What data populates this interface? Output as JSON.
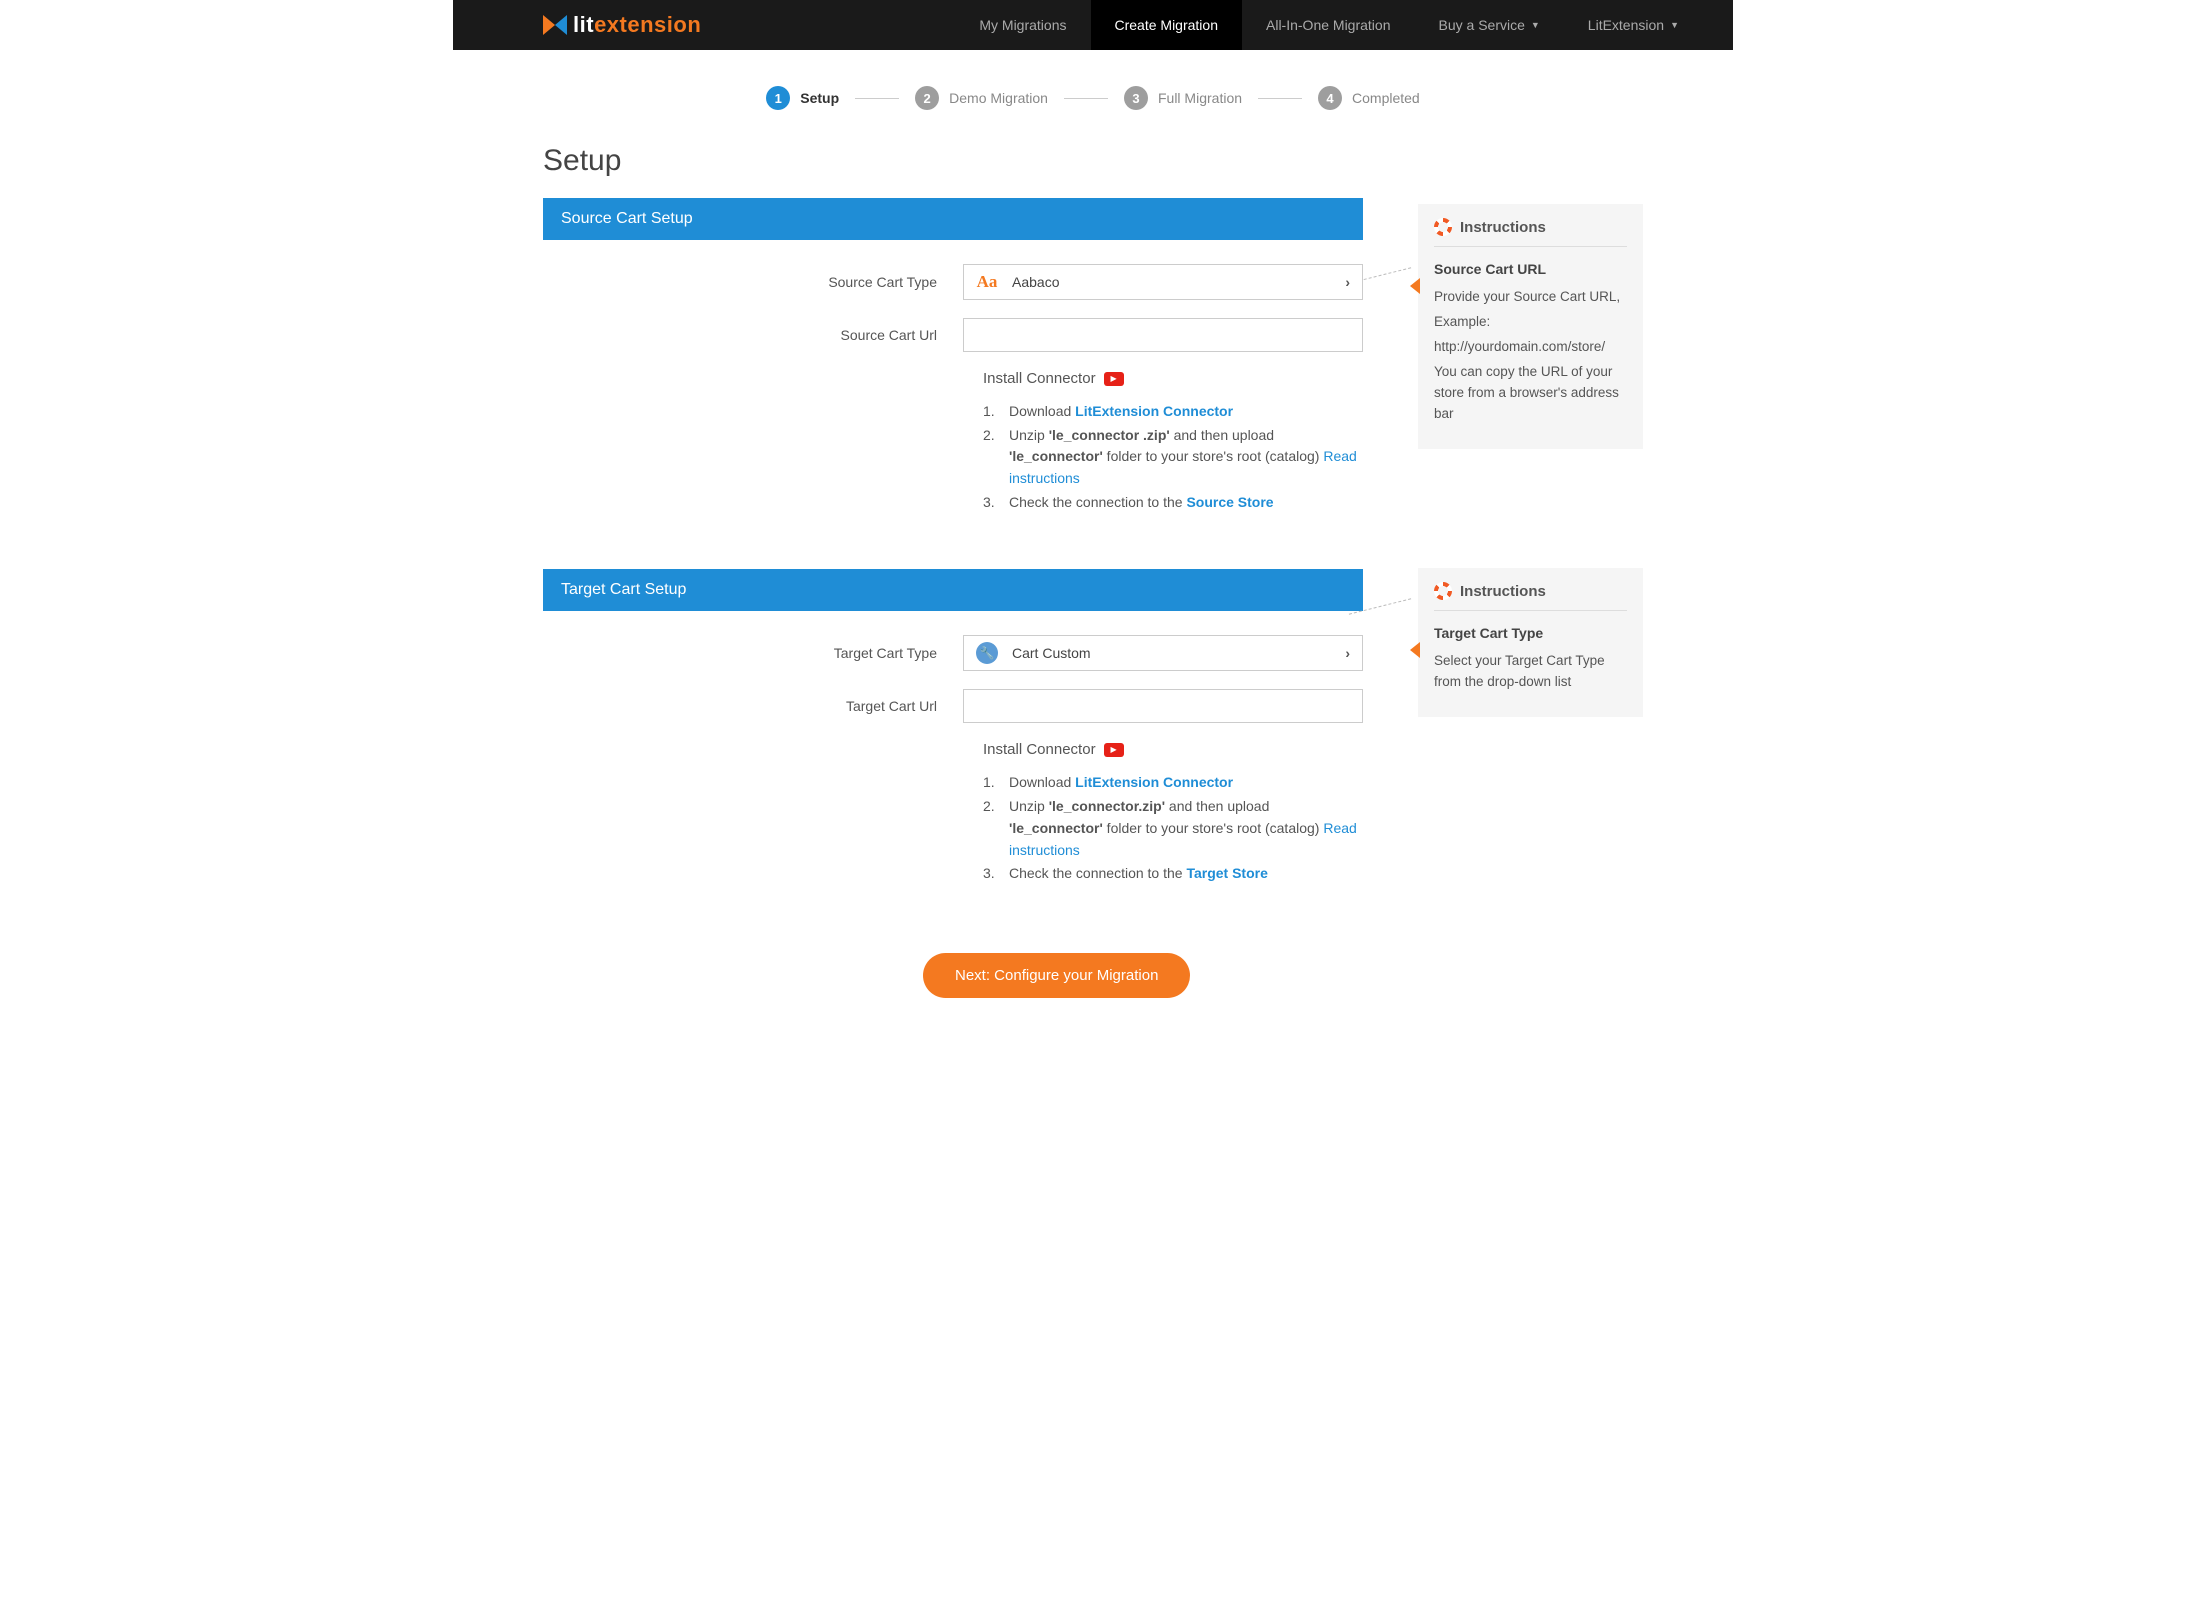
{
  "nav": {
    "brand_lit": "lit",
    "brand_ext": "extension",
    "items": [
      {
        "label": "My Migrations"
      },
      {
        "label": "Create Migration"
      },
      {
        "label": "All-In-One Migration"
      },
      {
        "label": "Buy a Service"
      },
      {
        "label": "LitExtension"
      }
    ]
  },
  "steps": [
    {
      "num": "1",
      "label": "Setup"
    },
    {
      "num": "2",
      "label": "Demo Migration"
    },
    {
      "num": "3",
      "label": "Full Migration"
    },
    {
      "num": "4",
      "label": "Completed"
    }
  ],
  "page_title": "Setup",
  "source": {
    "banner": "Source Cart Setup",
    "type_label": "Source Cart Type",
    "type_value": "Aabaco",
    "url_label": "Source Cart Url",
    "url_value": "",
    "install_title": "Install Connector",
    "connector": {
      "step1_pre": "Download ",
      "step1_link": "LitExtension Connector",
      "step2_a": "Unzip ",
      "step2_b": "'le_connector .zip'",
      "step2_c": " and then upload ",
      "step2_d": "'le_connector'",
      "step2_e": " folder to your store's root (catalog) ",
      "step2_link": "Read instructions",
      "step3_pre": "Check the connection to the ",
      "step3_link": "Source Store"
    }
  },
  "target": {
    "banner": "Target Cart Setup",
    "type_label": "Target Cart Type",
    "type_value": "Cart Custom",
    "url_label": "Target Cart Url",
    "url_value": "",
    "install_title": "Install Connector",
    "connector": {
      "step1_pre": "Download ",
      "step1_link": "LitExtension Connector",
      "step2_a": "Unzip ",
      "step2_b": "'le_connector.zip'",
      "step2_c": " and then upload ",
      "step2_d": "'le_connector'",
      "step2_e": " folder to your store's root (catalog) ",
      "step2_link": "Read instructions",
      "step3_pre": "Check the connection to the ",
      "step3_link": "Target Store"
    }
  },
  "instructions1": {
    "title": "Instructions",
    "subtitle": "Source Cart URL",
    "line1": "Provide your Source Cart URL,",
    "line2": "Example:",
    "line3": "http://yourdomain.com/store/",
    "line4": "You can copy the URL of your store from a browser's address bar"
  },
  "instructions2": {
    "title": "Instructions",
    "subtitle": "Target Cart Type",
    "body": "Select your Target Cart Type from the drop-down list"
  },
  "next_btn": "Next: Configure your Migration"
}
